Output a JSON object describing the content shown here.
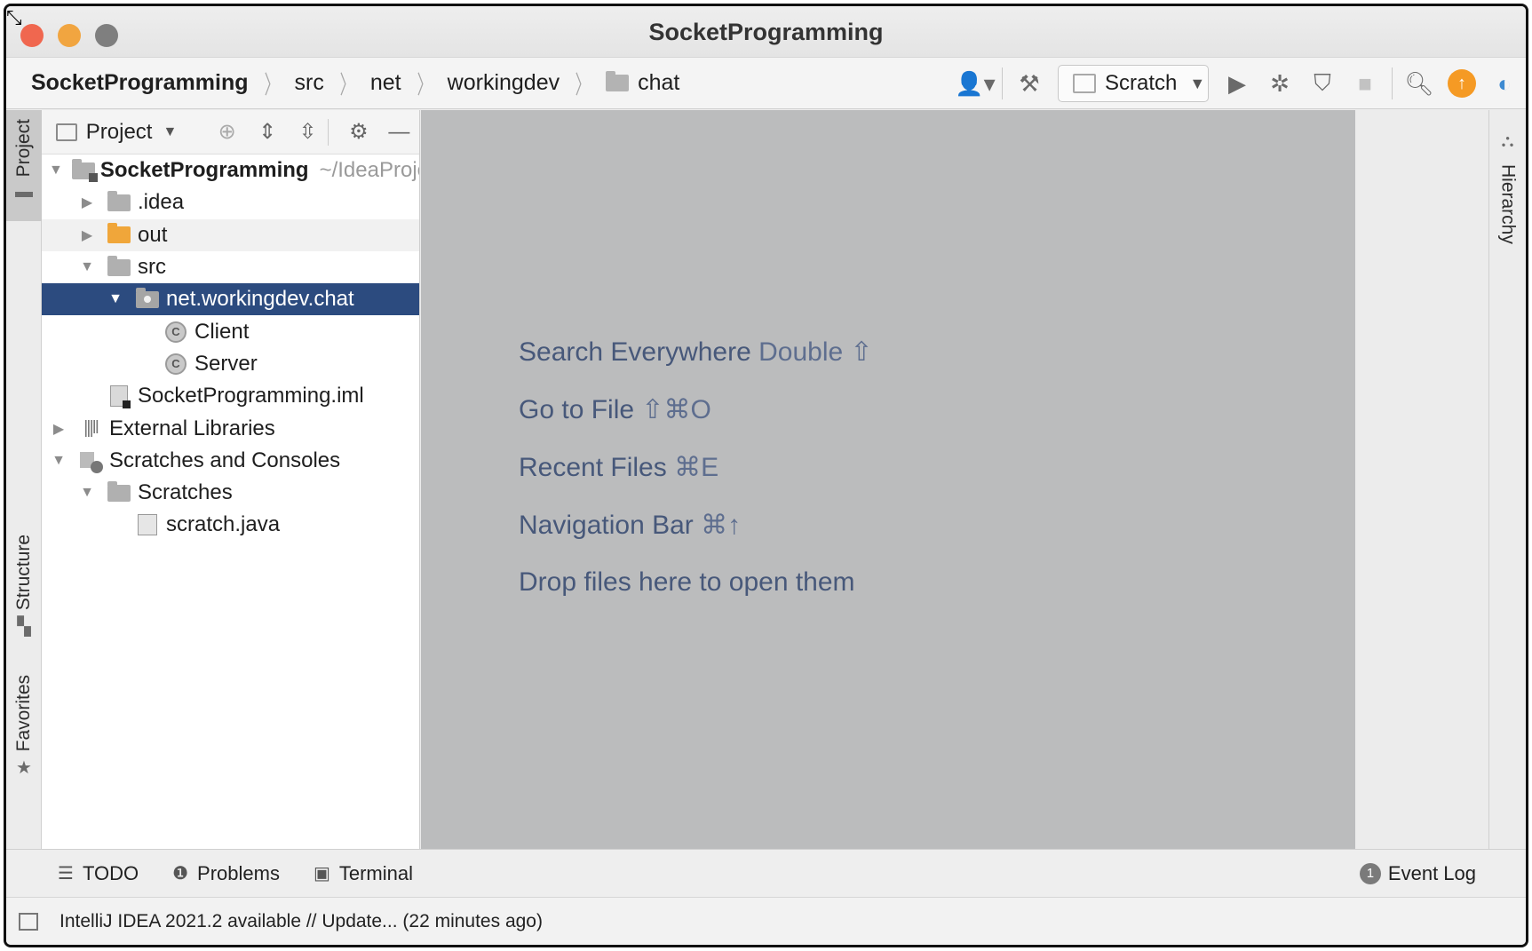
{
  "window": {
    "title": "SocketProgramming"
  },
  "navbar": {
    "crumbs": [
      "SocketProgramming",
      "src",
      "net",
      "workingdev",
      "chat"
    ],
    "run_config": "Scratch"
  },
  "left_stripe": {
    "project": "Project",
    "structure": "Structure",
    "favorites": "Favorites"
  },
  "right_stripe": {
    "hierarchy": "Hierarchy"
  },
  "project_panel": {
    "title": "Project",
    "tree": {
      "root": "SocketProgramming",
      "root_path": "~/IdeaProjects/SocketProgramming",
      "idea": ".idea",
      "out": "out",
      "src": "src",
      "package": "net.workingdev.chat",
      "client": "Client",
      "server": "Server",
      "iml": "SocketProgramming.iml",
      "external": "External Libraries",
      "scratches_consoles": "Scratches and Consoles",
      "scratches": "Scratches",
      "scratch_file": "scratch.java"
    }
  },
  "editor_hints": {
    "search_label": "Search Everywhere",
    "search_key": "Double ⇧",
    "goto_label": "Go to File",
    "goto_key": "⇧⌘O",
    "recent_label": "Recent Files",
    "recent_key": "⌘E",
    "nav_label": "Navigation Bar",
    "nav_key": "⌘↑",
    "drop": "Drop files here to open them"
  },
  "bottom_tabs": {
    "todo": "TODO",
    "problems": "Problems",
    "terminal": "Terminal",
    "event_log": "Event Log",
    "event_count": "1"
  },
  "status": {
    "text": "IntelliJ IDEA 2021.2 available // Update... (22 minutes ago)"
  },
  "colors": {
    "selection": "#2c4b7f",
    "editor_bg": "#bbbcbd",
    "hint_text": "#47587a",
    "update_badge": "#f59a24"
  }
}
